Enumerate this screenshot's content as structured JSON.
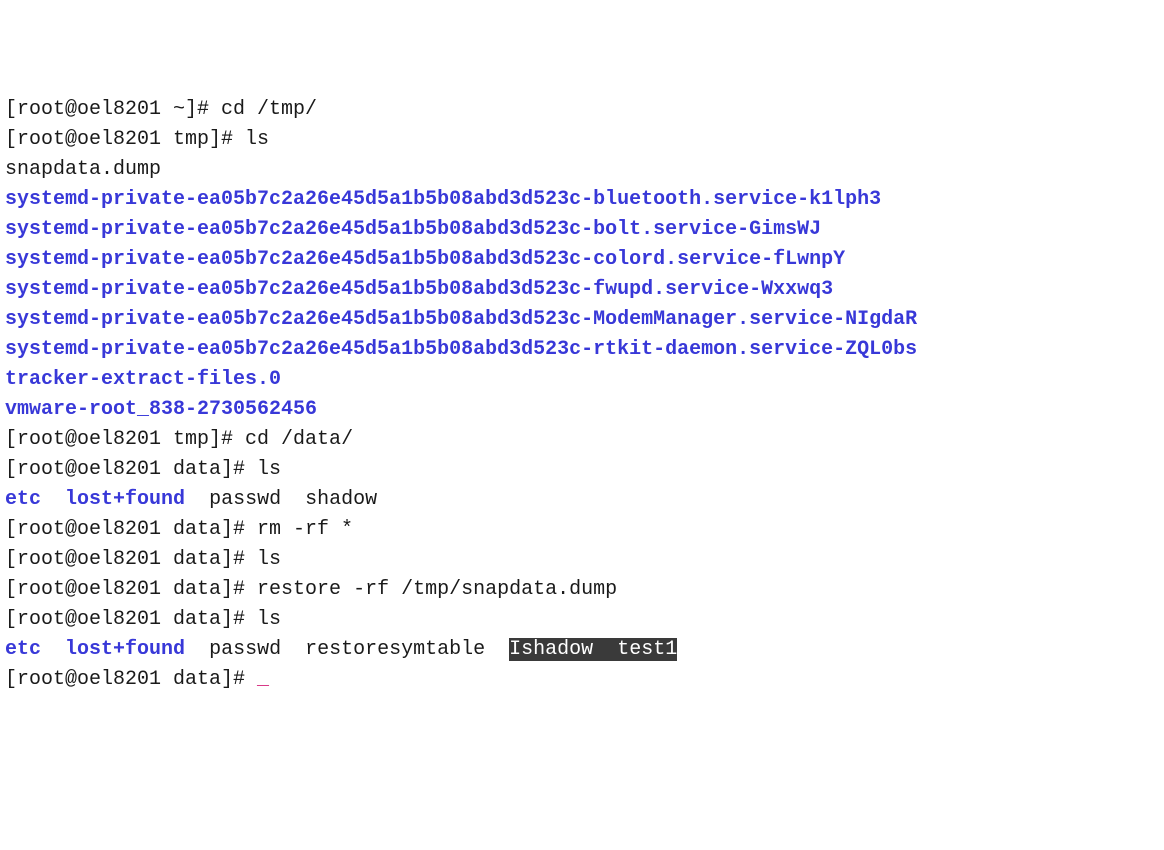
{
  "hostname": "oel8201",
  "users": {
    "root": "root"
  },
  "prompts": {
    "home": "[root@oel8201 ~]# ",
    "tmp": "[root@oel8201 tmp]# ",
    "data": "[root@oel8201 data]# "
  },
  "commands": {
    "cd_tmp": "cd /tmp/",
    "ls": "ls",
    "cd_data": "cd /data/",
    "rm_rf": "rm -rf *",
    "restore": "restore -rf /tmp/snapdata.dump"
  },
  "tmp_listing": {
    "plain": [
      "snapdata.dump"
    ],
    "dirs": [
      "systemd-private-ea05b7c2a26e45d5a1b5b08abd3d523c-bluetooth.service-k1lph3",
      "systemd-private-ea05b7c2a26e45d5a1b5b08abd3d523c-bolt.service-GimsWJ",
      "systemd-private-ea05b7c2a26e45d5a1b5b08abd3d523c-colord.service-fLwnpY",
      "systemd-private-ea05b7c2a26e45d5a1b5b08abd3d523c-fwupd.service-Wxxwq3",
      "systemd-private-ea05b7c2a26e45d5a1b5b08abd3d523c-ModemManager.service-NIgdaR",
      "systemd-private-ea05b7c2a26e45d5a1b5b08abd3d523c-rtkit-daemon.service-ZQL0bs",
      "tracker-extract-files.0",
      "vmware-root_838-2730562456"
    ]
  },
  "data_listing_before": {
    "dirs": [
      "etc",
      "lost+found"
    ],
    "files": [
      "passwd",
      "shadow"
    ]
  },
  "data_listing_after": {
    "dirs": [
      "etc",
      "lost+found"
    ],
    "files_plain": [
      "passwd",
      "restoresymtable"
    ],
    "files_highlighted": "shadow  test1"
  },
  "cursor_char": "_",
  "ibeam_char": "I"
}
